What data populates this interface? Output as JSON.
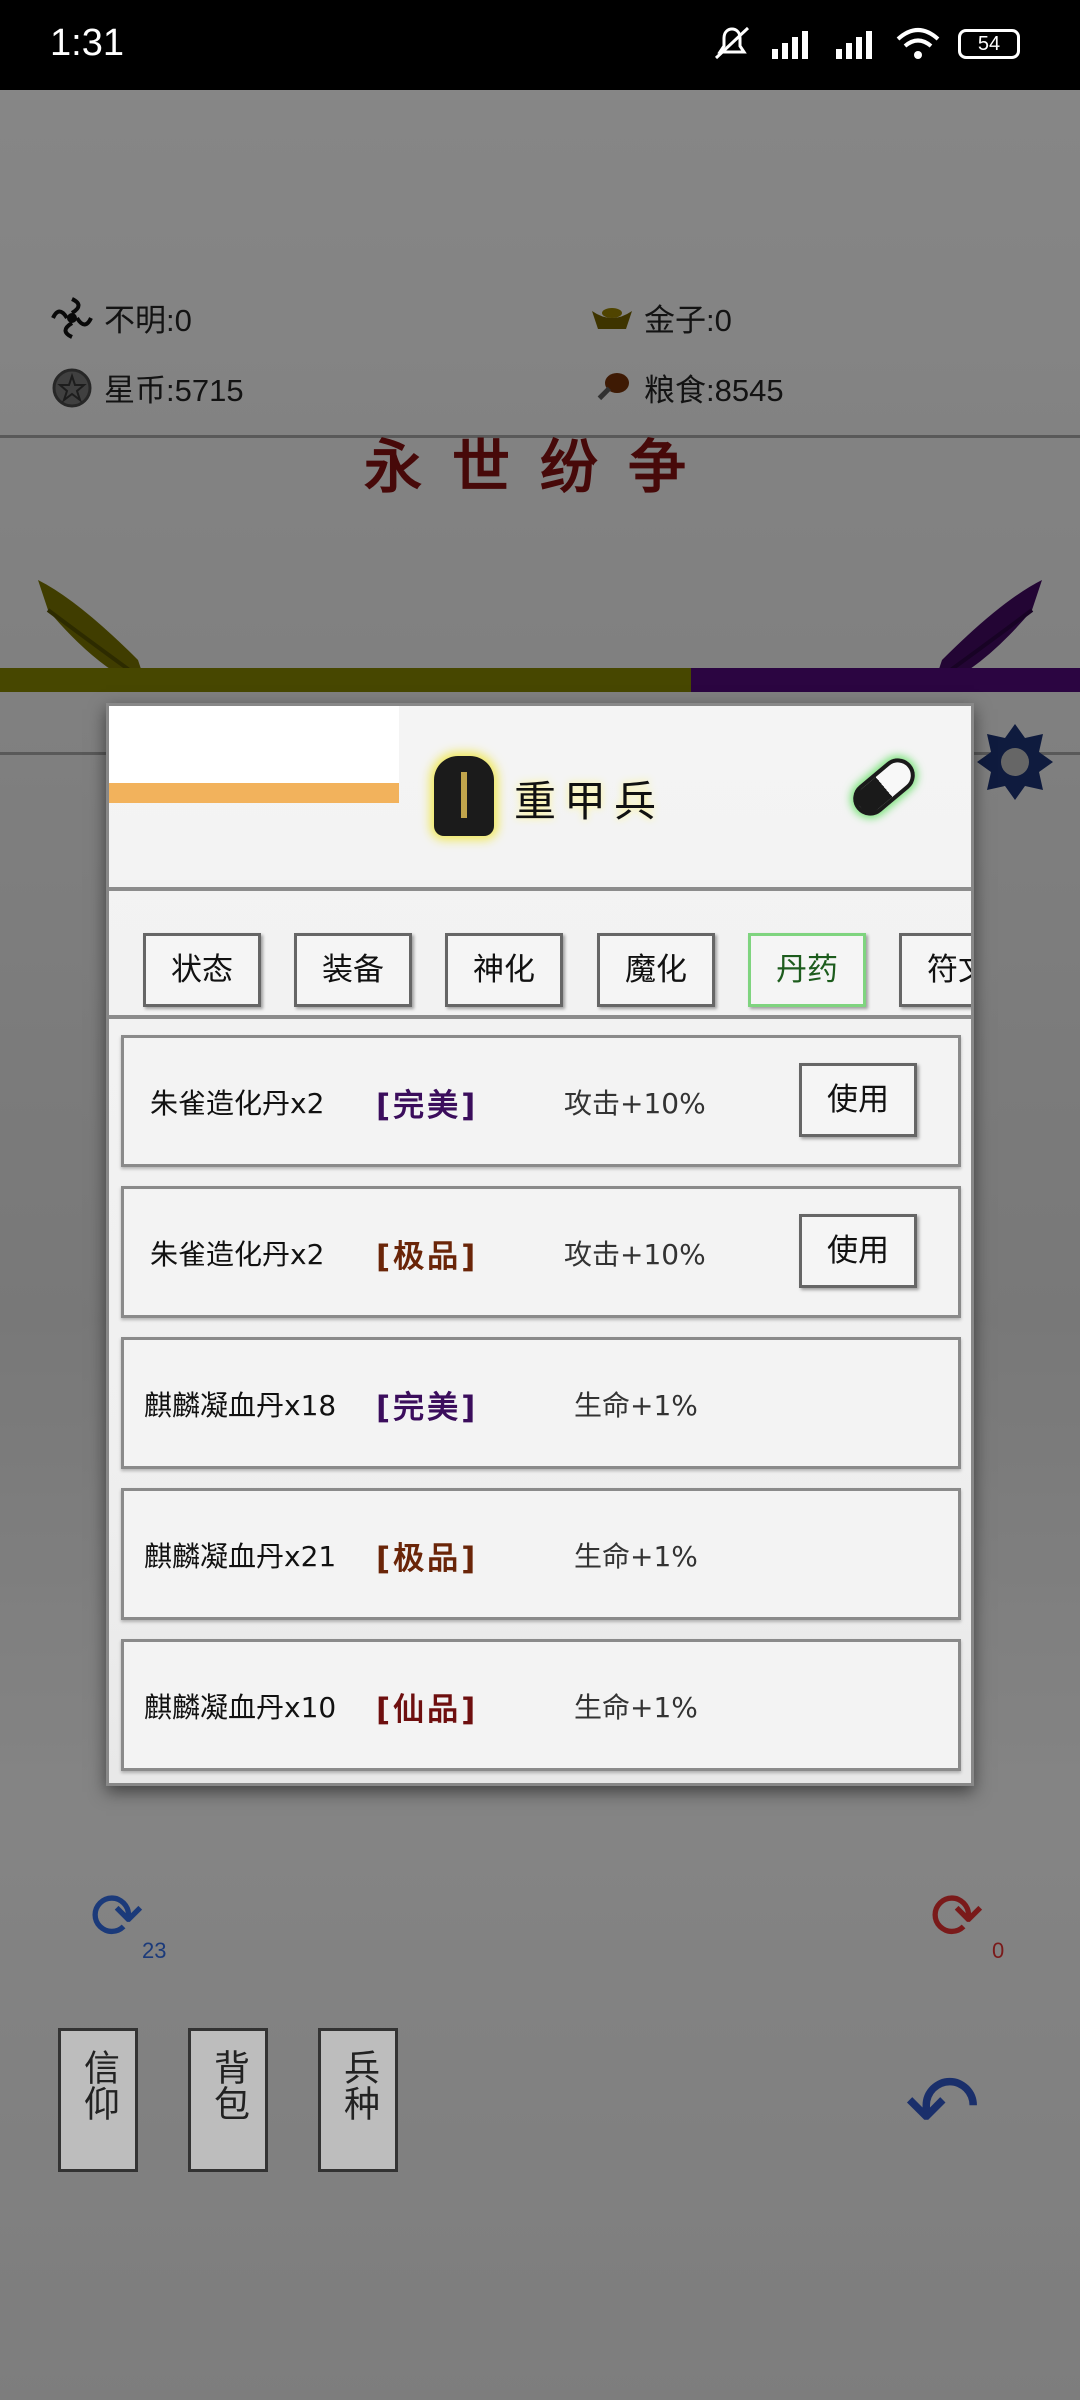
{
  "status_bar": {
    "time": "1:31",
    "battery": "54"
  },
  "resources": {
    "unknown": "不明:0",
    "gold": "金子:0",
    "star_coin": "星币:5715",
    "food": "粮食:8545"
  },
  "game": {
    "title": "永世纷争",
    "progress_fraction": 0.64
  },
  "bottom": {
    "left_count": "23",
    "right_count": "0",
    "faith_label": "信仰",
    "bag_label": "背包",
    "units_label": "兵种"
  },
  "modal": {
    "unit_name": "重甲兵",
    "tabs": [
      {
        "label": "状态"
      },
      {
        "label": "装备"
      },
      {
        "label": "神化"
      },
      {
        "label": "魔化"
      },
      {
        "label": "丹药"
      },
      {
        "label": "符文"
      }
    ],
    "active_tab": "丹药",
    "items": [
      {
        "name": "朱雀造化丹x2",
        "quality": "[完美]",
        "effect": "攻击+10%",
        "button": "使用"
      },
      {
        "name": "朱雀造化丹x2",
        "quality": "[极品]",
        "effect": "攻击+10%",
        "button": "使用"
      },
      {
        "name": "麒麟凝血丹x18",
        "quality": "[完美]",
        "effect": "生命+1%"
      },
      {
        "name": "麒麟凝血丹x21",
        "quality": "[极品]",
        "effect": "生命+1%"
      },
      {
        "name": "麒麟凝血丹x10",
        "quality": "[仙品]",
        "effect": "生命+1%"
      }
    ],
    "quality_colors": {
      "完美": "#3b0d5c",
      "极品": "#6a2508",
      "仙品": "#6e0f0f"
    }
  }
}
